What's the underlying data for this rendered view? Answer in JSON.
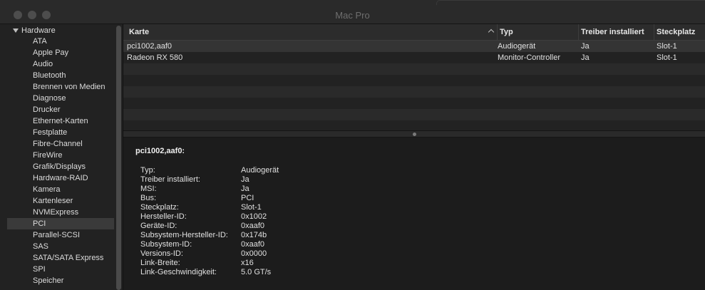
{
  "window": {
    "title": "Mac Pro"
  },
  "sidebar": {
    "section": "Hardware",
    "items": [
      "ATA",
      "Apple Pay",
      "Audio",
      "Bluetooth",
      "Brennen von Medien",
      "Diagnose",
      "Drucker",
      "Ethernet-Karten",
      "Festplatte",
      "Fibre-Channel",
      "FireWire",
      "Grafik/Displays",
      "Hardware-RAID",
      "Kamera",
      "Kartenleser",
      "NVMExpress",
      "PCI",
      "Parallel-SCSI",
      "SAS",
      "SATA/SATA Express",
      "SPI",
      "Speicher"
    ],
    "selected": "PCI"
  },
  "table": {
    "columns": {
      "karte": "Karte",
      "typ": "Typ",
      "treiber": "Treiber installiert",
      "slot": "Steckplatz"
    },
    "rows": [
      {
        "karte": "pci1002,aaf0",
        "typ": "Audiogerät",
        "treiber": "Ja",
        "slot": "Slot-1"
      },
      {
        "karte": "Radeon RX 580",
        "typ": "Monitor-Controller",
        "treiber": "Ja",
        "slot": "Slot-1"
      }
    ]
  },
  "detail": {
    "title": "pci1002,aaf0:",
    "properties": [
      {
        "label": "Typ:",
        "value": "Audiogerät"
      },
      {
        "label": "Treiber installiert:",
        "value": "Ja"
      },
      {
        "label": "MSI:",
        "value": "Ja"
      },
      {
        "label": "Bus:",
        "value": "PCI"
      },
      {
        "label": "Steckplatz:",
        "value": "Slot-1"
      },
      {
        "label": "Hersteller-ID:",
        "value": "0x1002"
      },
      {
        "label": "Geräte-ID:",
        "value": "0xaaf0"
      },
      {
        "label": "Subsystem-Hersteller-ID:",
        "value": "0x174b"
      },
      {
        "label": "Subsystem-ID:",
        "value": "0xaaf0"
      },
      {
        "label": "Versions-ID:",
        "value": "0x0000"
      },
      {
        "label": "Link-Breite:",
        "value": "x16"
      },
      {
        "label": "Link-Geschwindigkeit:",
        "value": "5.0 GT/s"
      }
    ]
  },
  "colors": {
    "window_bg": "#1f1f1f",
    "selection": "#3a3a3a",
    "text": "#dcdcdc"
  }
}
